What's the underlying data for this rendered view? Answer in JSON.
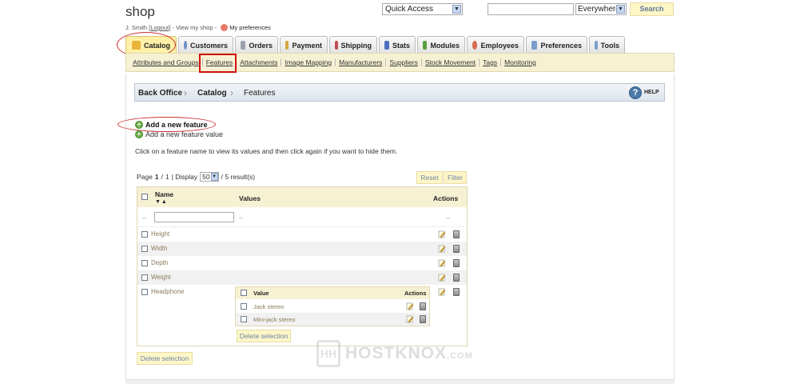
{
  "header": {
    "shop_title": "shop",
    "user_name": "J. Smith",
    "logout_label": "Logout",
    "view_shop_label": "View my shop",
    "preferences_label": "My preferences",
    "quick_access": "Quick Access",
    "search_scope": "Everywhere",
    "search_button": "Search"
  },
  "tabs": [
    {
      "label": "Catalog",
      "color": "#e8b43a",
      "active": true
    },
    {
      "label": "Customers",
      "color": "#6b8cc4"
    },
    {
      "label": "Orders",
      "color": "#9aa2ab"
    },
    {
      "label": "Payment",
      "color": "#d4a43c"
    },
    {
      "label": "Shipping",
      "color": "#c05050"
    },
    {
      "label": "Stats",
      "color": "#4a70c0"
    },
    {
      "label": "Modules",
      "color": "#5aa040"
    },
    {
      "label": "Employees",
      "color": "#d56a50"
    },
    {
      "label": "Preferences",
      "color": "#7a9ccc"
    },
    {
      "label": "Tools",
      "color": "#7aa0c8"
    }
  ],
  "subnav": [
    "Attributes and Groups",
    "Features",
    "Attachments",
    "Image Mapping",
    "Manufacturers",
    "Suppliers",
    "Stock Movement",
    "Tags",
    "Monitoring"
  ],
  "breadcrumb": {
    "root": "Back Office",
    "section": "Catalog",
    "page": "Features",
    "help_label": "HELP"
  },
  "actions": {
    "add_feature": "Add a new feature",
    "add_feature_value": "Add a new feature value",
    "info": "Click on a feature name to view its values and then click again if you want to hide them."
  },
  "pager": {
    "page_prefix": "Page",
    "current": "1",
    "total": "1",
    "display_label": "| Display",
    "per_page": "50",
    "results": "/ 5 result(s)",
    "reset": "Reset",
    "filter": "Filter"
  },
  "table": {
    "col_name": "Name",
    "col_values": "Values",
    "col_actions": "Actions",
    "filter_dash": "--",
    "rows": [
      "Height",
      "Width",
      "Depth",
      "Weight",
      "Headphone"
    ]
  },
  "subtable": {
    "col_value": "Value",
    "col_actions": "Actions",
    "rows": [
      "Jack stereo",
      "Mini-jack stereo"
    ],
    "delete_selection": "Delete selection"
  },
  "delete_selection": "Delete selection",
  "watermark": {
    "logo": "HH",
    "name": "HOSTKNOX",
    "suffix": ".COM"
  }
}
